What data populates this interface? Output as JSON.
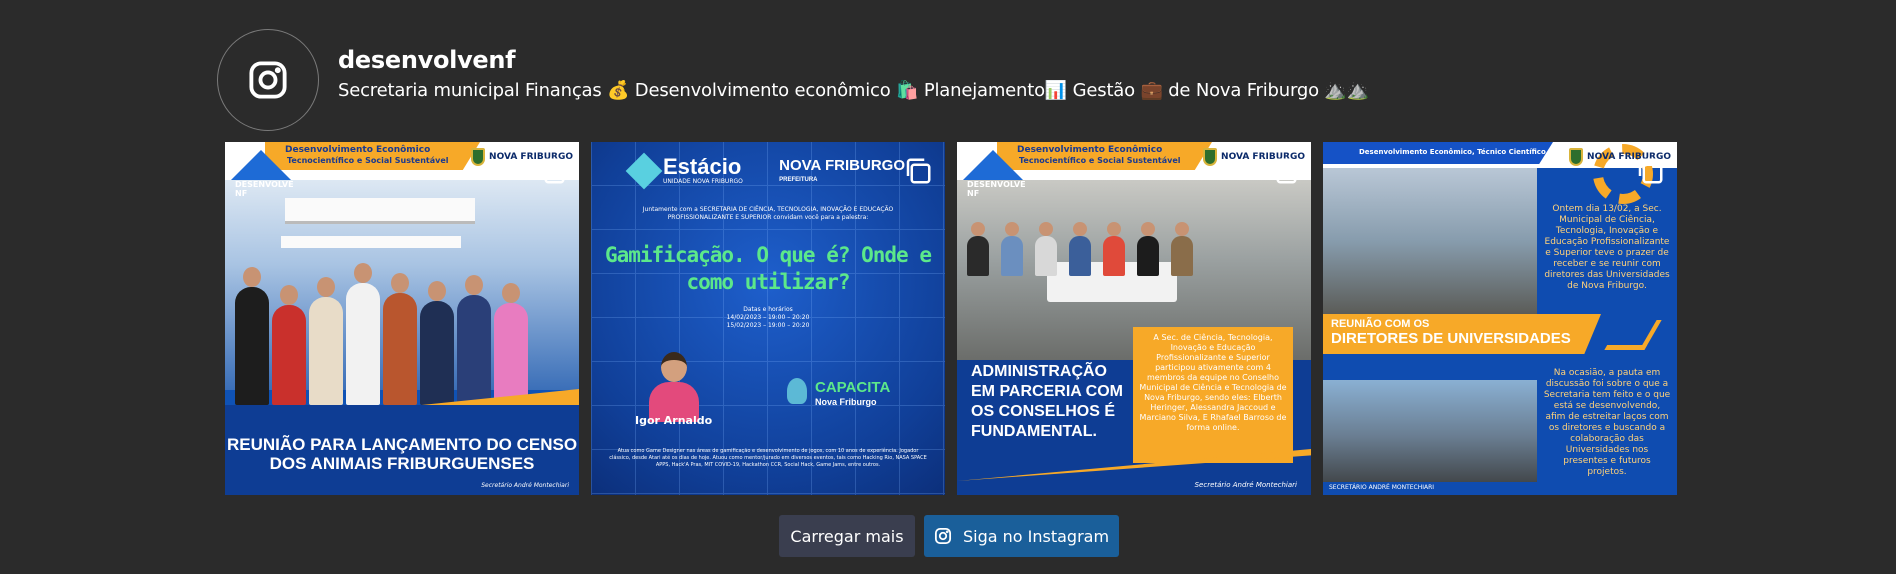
{
  "profile": {
    "username": "desenvolvenf",
    "bio": "Secretaria municipal Finanças 💰 Desenvolvimento econômico 🛍️ Planejamento📊 Gestão 💼 de Nova Friburgo ⛰️⛰️",
    "avatar_icon": "instagram-icon"
  },
  "posts": [
    {
      "banner_line1": "Desenvolvimento Econômico",
      "banner_line2": "Tecnocientífico e Social Sustentável",
      "logo_text": "DESENVOLVE NF",
      "city_text": "NOVA FRIBURGO",
      "caption": "REUNIÃO PARA LANÇAMENTO DO CENSO DOS ANIMAIS FRIBURGUENSES",
      "signature": "Secretário André Montechiari",
      "type_icon": "carousel-icon"
    },
    {
      "brand": "Estácio",
      "brand_sub": "UNIDADE NOVA FRIBURGO",
      "city_text": "NOVA FRIBURGO",
      "city_sub": "PREFEITURA",
      "intro": "Juntamente com a SECRETARIA DE CIÊNCIA, TECNOLOGIA, INOVAÇÃO E EDUCAÇÃO PROFISSIONALIZANTE E SUPERIOR convidam você para a palestra:",
      "headline": "Gamificação. O que é? Onde e como utilizar?",
      "dates_title": "Datas e horários",
      "date1": "14/02/2023 – 19:00 – 20:20",
      "date2": "15/02/2023 – 19:00 – 20:20",
      "speaker": "Igor Arnaldo",
      "program": "CAPACITA",
      "program_sub": "Nova Friburgo",
      "speaker_bio": "Atua como Game Designer nas áreas de gamificação e desenvolvimento de jogos, com 10 anos de experiência. Jogador clássico, desde Atari até os dias de hoje. Atuou como mentor/jurado em diversos eventos, tais como Hacking Rio, NASA SPACE APPS, Hack'A Pras, MIT COVID-19, Hackathon CCR, Social Hack, Game Jams, entre outros.",
      "type_icon": "carousel-icon"
    },
    {
      "banner_line1": "Desenvolvimento Econômico",
      "banner_line2": "Tecnocientífico e Social Sustentável",
      "logo_text": "DESENVOLVE NF",
      "city_text": "NOVA FRIBURGO",
      "box_text": "A Sec. de Ciência, Tecnologia, Inovação e Educação Profissionalizante e Superior participou ativamente com 4 membros da equipe no Conselho Municipal de Ciência e Tecnologia de Nova Friburgo, sendo eles: Elberth Heringer, Alessandra Jaccoud e Marciano Silva, E Rhafael Barroso de forma online.",
      "headline": "ADMINISTRAÇÃO EM PARCERIA COM OS CONSELHOS É FUNDAMENTAL.",
      "signature": "Secretário André Montechiari",
      "type_icon": "carousel-icon"
    },
    {
      "banner": "Desenvolvimento Econômico, Técnico Científico e Social",
      "city_text": "NOVA FRIBURGO",
      "text1": "Ontem dia 13/02, a Sec. Municipal de Ciência, Tecnologia, Inovação e Educação Profissionalizante e Superior teve o prazer de receber e se reunir com diretores das Universidades de Nova Friburgo.",
      "title_line1": "REUNIÃO COM OS",
      "title_line2": "DIRETORES DE UNIVERSIDADES",
      "text2": "Na ocasião, a pauta em discussão foi sobre o que a Secretaria tem feito e o que está se desenvolvendo, afim de estreitar laços com os diretores e buscando a colaboração das Universidades nos presentes e futuros projetos.",
      "signature": "SECRETÁRIO ANDRÉ MONTECHIARI",
      "type_icon": "carousel-icon"
    }
  ],
  "actions": {
    "load_more": "Carregar mais",
    "follow": "Siga no Instagram"
  },
  "colors": {
    "background": "#2b2b2b",
    "load_more_bg": "#3a3e4f",
    "follow_bg": "#1a5f9a",
    "accent_orange": "#f7a928",
    "accent_blue": "#0f52b5"
  }
}
